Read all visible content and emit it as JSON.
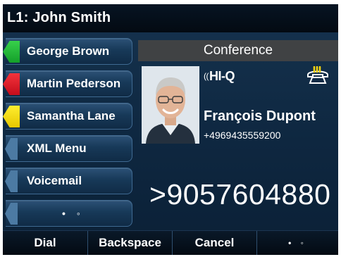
{
  "header": {
    "line_title": "L1: John Smith"
  },
  "line_keys": [
    {
      "label": "George Brown",
      "status_color": "#22b83a"
    },
    {
      "label": "Martin Pederson",
      "status_color": "#e3202b"
    },
    {
      "label": "Samantha Lane",
      "status_color": "#f5da14"
    },
    {
      "label": "XML Menu"
    },
    {
      "label": "Voicemail"
    },
    {
      "label": "• ◦"
    }
  ],
  "call": {
    "state": "Conference",
    "hiq_label": "HI-Q",
    "caller_name": "François Dupont",
    "caller_number": "+4969435559200",
    "dialed_number": ">9057604880"
  },
  "soft_keys": [
    {
      "label": "Dial"
    },
    {
      "label": "Backspace"
    },
    {
      "label": "Cancel"
    },
    {
      "label": "• ◦"
    }
  ],
  "icons": {
    "hiq": "hi-q-audio-icon",
    "handset": "off-hook-phone-icon",
    "avatar": "contact-photo"
  },
  "colors": {
    "background": "#0e2740",
    "header": "#030a12",
    "conference_bar": "#404244",
    "handset_icon": "#f2d312"
  }
}
